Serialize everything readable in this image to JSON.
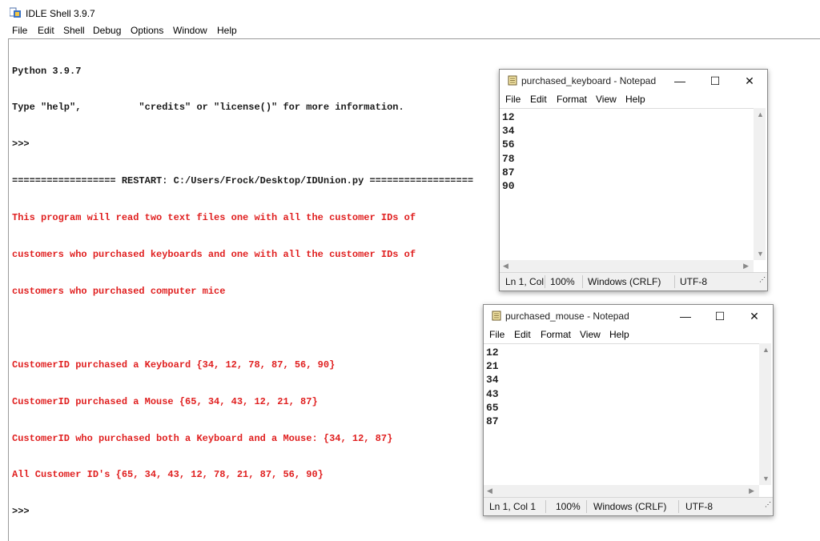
{
  "idle": {
    "title": "IDLE Shell 3.9.7",
    "menu": [
      "File",
      "Edit",
      "Shell",
      "Debug",
      "Options",
      "Window",
      "Help"
    ],
    "output_lines": [
      {
        "text": "Python 3.9.7",
        "color": "black"
      },
      {
        "text": "Type \"help\",          \"credits\" or \"license()\" for more information.",
        "color": "black"
      },
      {
        "text": ">>>",
        "color": "black"
      },
      {
        "text": "================== RESTART: C:/Users/Frock/Desktop/IDUnion.py ==================",
        "color": "black"
      },
      {
        "text": "This program will read two text files one with all the customer IDs of",
        "color": "red"
      },
      {
        "text": "customers who purchased keyboards and one with all the customer IDs of",
        "color": "red"
      },
      {
        "text": "customers who purchased computer mice",
        "color": "red"
      },
      {
        "text": "",
        "color": "red"
      },
      {
        "text": "CustomerID purchased a Keyboard {34, 12, 78, 87, 56, 90}",
        "color": "red"
      },
      {
        "text": "CustomerID purchased a Mouse {65, 34, 43, 12, 21, 87}",
        "color": "red"
      },
      {
        "text": "CustomerID who purchased both a Keyboard and a Mouse: {34, 12, 87}",
        "color": "red"
      },
      {
        "text": "All Customer ID's {65, 34, 43, 12, 78, 21, 87, 56, 90}",
        "color": "red"
      },
      {
        "text": ">>>",
        "color": "black"
      }
    ]
  },
  "notepad_keyboard": {
    "title": "purchased_keyboard - Notepad",
    "menu": [
      "File",
      "Edit",
      "Format",
      "View",
      "Help"
    ],
    "lines": [
      "12",
      "34",
      "56",
      "78",
      "87",
      "90"
    ],
    "status": {
      "position": "Ln 1, Col",
      "zoom": "100%",
      "eol": "Windows (CRLF)",
      "encoding": "UTF-8"
    }
  },
  "notepad_mouse": {
    "title": "purchased_mouse - Notepad",
    "menu": [
      "File",
      "Edit",
      "Format",
      "View",
      "Help"
    ],
    "lines": [
      "12",
      "21",
      "34",
      "43",
      "65",
      "87"
    ],
    "status": {
      "position": "Ln 1, Col 1",
      "zoom": "100%",
      "eol": "Windows (CRLF)",
      "encoding": "UTF-8"
    }
  },
  "window_buttons": {
    "minimize": "—",
    "maximize": "☐",
    "close": "✕"
  },
  "colors": {
    "output_red": "#e02020",
    "output_black": "#1a1a1a"
  }
}
